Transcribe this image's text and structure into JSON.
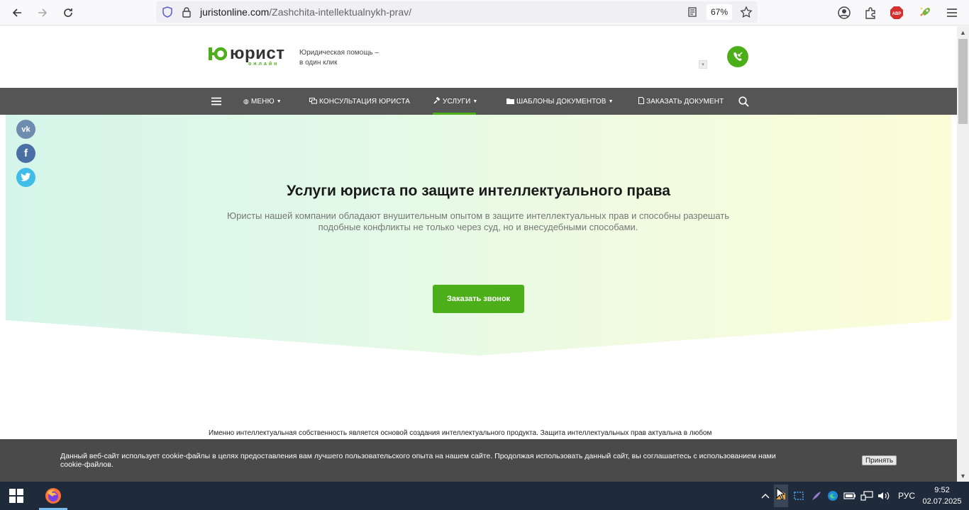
{
  "browser": {
    "url_host": "juristonline.com",
    "url_path": "/Zashchita-intellektualnykh-prav/",
    "zoom": "67%"
  },
  "header": {
    "logo_text": "юрист",
    "logo_sub": "онлайн",
    "tagline_line1": "Юридическая помощь –",
    "tagline_line2": "в один клик",
    "select_caret": "▾"
  },
  "nav": {
    "items": [
      {
        "label": "МЕНЮ"
      },
      {
        "label": "КОНСУЛЬТАЦИЯ ЮРИСТА"
      },
      {
        "label": "УСЛУГИ"
      },
      {
        "label": "ШАБЛОНЫ ДОКУМЕНТОВ"
      },
      {
        "label": "ЗАКАЗАТЬ ДОКУМЕНТ"
      }
    ],
    "active_index": 2
  },
  "social": {
    "vk": "vk",
    "facebook": "f"
  },
  "hero": {
    "title": "Услуги юриста по защите интеллектуального права",
    "description": "Юристы нашей компании обладают внушительным опытом в защите интеллектуальных прав и способны разрешать подобные конфликты не только через суд, но и внесудебными способами.",
    "cta_label": "Заказать звонок"
  },
  "body": {
    "text": "Именно интеллектуальная собственность является основой создания интеллектуального продукта. Защита интеллектуальных прав актуальна в любом"
  },
  "cookie": {
    "text": "Данный веб-сайт использует cookie-файлы в целях предоставления вам лучшего пользовательского опыта на нашем сайте. Продолжая использовать данный сайт, вы соглашаетесь с использованием нами cookie-файлов.",
    "accept_label": "Принять"
  },
  "taskbar": {
    "language": "РУС",
    "time": "9:52",
    "date": "02.07.2025"
  },
  "colors": {
    "brand_green": "#4caf1a",
    "nav_bg": "#555555",
    "cookie_bg": "#4a4a4a",
    "taskbar_bg": "#1f2b3a"
  }
}
